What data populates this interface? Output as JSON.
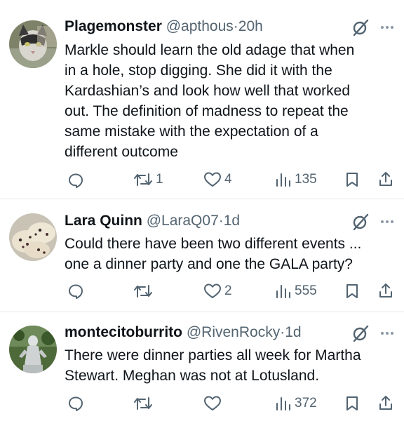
{
  "colors": {
    "text": "#0f1419",
    "muted": "#536471",
    "divider": "#e6e9eb"
  },
  "tweets": [
    {
      "name": "Plagemonster",
      "handle": "@apthous",
      "dot": "·",
      "time": "20h",
      "lines": [
        "Markle should learn the old adage that when",
        "in a hole, stop digging. She did it with the",
        "Kardashian’s and look how well that worked",
        "out. The definition of madness to repeat the",
        "same mistake with the expectation of a",
        "different outcome"
      ],
      "replies": "",
      "reposts": "1",
      "likes": "4",
      "views": "135",
      "avatar": "cat-avatar"
    },
    {
      "name": "Lara Quinn",
      "handle": "@LaraQ07",
      "dot": "·",
      "time": "1d",
      "lines": [
        "Could there have been two different events ...",
        "one a dinner party and one the GALA party?"
      ],
      "replies": "",
      "reposts": "",
      "likes": "2",
      "views": "555",
      "avatar": "cookies-avatar"
    },
    {
      "name": "montecitoburrito",
      "handle": "@RivenRocky",
      "dot": "·",
      "time": "1d",
      "lines": [
        "There were dinner parties all week for Martha",
        "Stewart. Meghan was not at Lotusland."
      ],
      "replies": "",
      "reposts": "",
      "likes": "",
      "views": "372",
      "avatar": "statue-avatar"
    }
  ]
}
